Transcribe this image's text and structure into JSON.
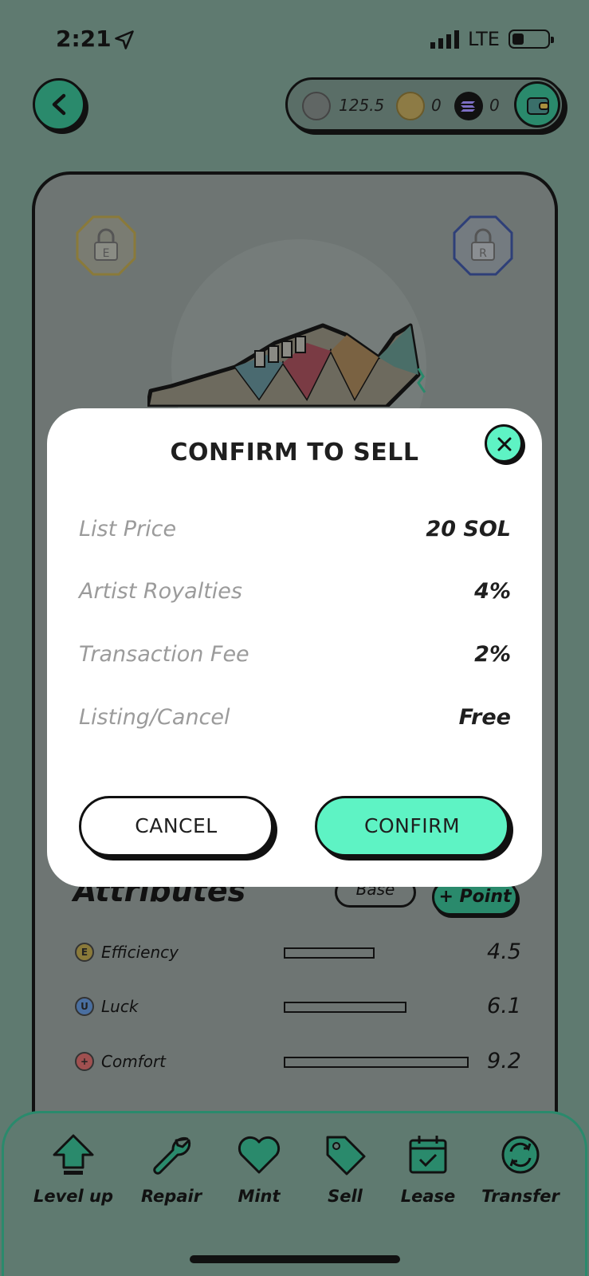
{
  "status_bar": {
    "time": "2:21",
    "network": "LTE"
  },
  "balances": {
    "gst": "125.5",
    "gmt": "0",
    "sol": "0"
  },
  "modal": {
    "title": "CONFIRM TO SELL",
    "rows": [
      {
        "label": "List Price",
        "value": "20 SOL"
      },
      {
        "label": "Artist Royalties",
        "value": "4%"
      },
      {
        "label": "Transaction Fee",
        "value": "2%"
      },
      {
        "label": "Listing/Cancel",
        "value": "Free"
      }
    ],
    "cancel_label": "CANCEL",
    "confirm_label": "CONFIRM"
  },
  "attributes": {
    "title": "Attributes",
    "base_label": "Base",
    "point_label": "+ Point",
    "items": [
      {
        "name": "Efficiency",
        "value": "4.5",
        "icon": "E"
      },
      {
        "name": "Luck",
        "value": "6.1",
        "icon": "U"
      },
      {
        "name": "Comfort",
        "value": "9.2",
        "icon": "+"
      }
    ]
  },
  "actions": [
    {
      "label": "Level up",
      "icon": "level-up-icon"
    },
    {
      "label": "Repair",
      "icon": "wrench-icon"
    },
    {
      "label": "Mint",
      "icon": "heart-icon"
    },
    {
      "label": "Sell",
      "icon": "tag-icon"
    },
    {
      "label": "Lease",
      "icon": "calendar-icon"
    },
    {
      "label": "Transfer",
      "icon": "transfer-icon"
    }
  ],
  "colors": {
    "accent": "#5ef3c4",
    "dark_green": "#2a8a6c",
    "overlay": "#5f7a70"
  }
}
